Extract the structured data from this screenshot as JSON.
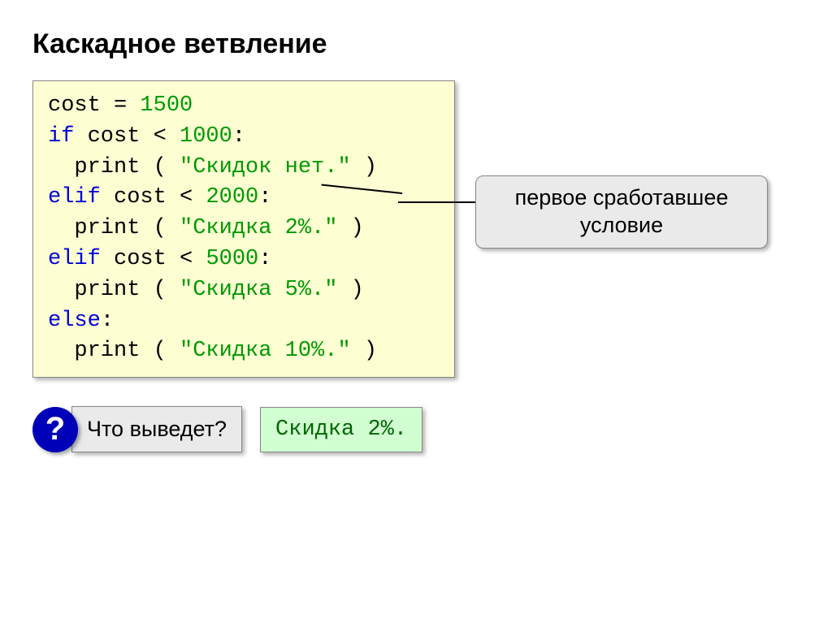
{
  "title": "Каскадное ветвление",
  "code": {
    "l1a": "cost = ",
    "l1b": "1500",
    "l2a": "if",
    "l2b": " cost < ",
    "l2c": "1000",
    "l2d": ":",
    "l3a": "  print ( ",
    "l3b": "\"Скидок нет.\"",
    "l3c": " )",
    "l4a": "elif",
    "l4b": " cost < ",
    "l4c": "2000",
    "l4d": ":",
    "l5a": "  print ( ",
    "l5b": "\"Скидка 2%.\"",
    "l5c": " )",
    "l6a": "elif",
    "l6b": " cost < ",
    "l6c": "5000",
    "l6d": ":",
    "l7a": "  print ( ",
    "l7b": "\"Скидка 5%.\"",
    "l7c": " )",
    "l8a": "else",
    "l8b": ":",
    "l9a": "  print ( ",
    "l9b": "\"Скидка 10%.\"",
    "l9c": " )"
  },
  "callout": "первое сработавшее условие",
  "qmark": "?",
  "question": "Что выведет?",
  "answer": "Скидка 2%."
}
